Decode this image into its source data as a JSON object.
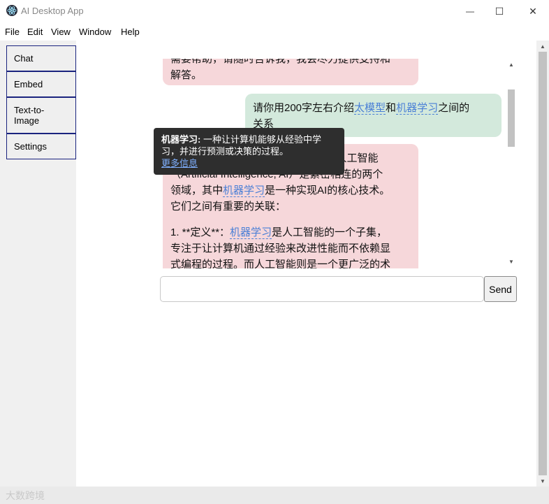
{
  "window": {
    "title": "AI Desktop App",
    "minimize_symbol": "—",
    "maximize_symbol": "☐",
    "close_symbol": "✕",
    "icon": "electron-atom-icon"
  },
  "menu": [
    "File",
    "Edit",
    "View",
    "Window",
    "Help"
  ],
  "sidebar": {
    "chat_label": "Chat",
    "embed_label": "Embed",
    "text_to_image_line1": "Text-to-",
    "text_to_image_line2": "Image",
    "settings_label": "Settings"
  },
  "messages": {
    "m1_line1": "需要帮助，请随时告诉我，我会尽力提供支持和",
    "m1_line2": "解答。",
    "m2_pre": "请你用200字左右介绍",
    "m2_link1": "太模型",
    "m2_mid": "和",
    "m2_link2": "机器学习",
    "m2_post": "之间的",
    "m2_line2": "关系",
    "m3_line1": "人工智能（Artificial Intelligence）和人工智能",
    "m3_line2": "（Artificial Intelligence, AI）是紧密相连的两个",
    "m3_l3_pre": "领域，其中",
    "m3_l3_link": "机器学习",
    "m3_l3_post": "是一种实现AI的核心技术。",
    "m3_line4": "它们之间有重要的关联：",
    "m3_l5_pre": "1. **定义**：",
    "m3_l5_link": "机器学习",
    "m3_l5_post": "是人工智能的一个子集，",
    "m3_line6": "专注于让计算机通过经验来改进性能而不依赖显",
    "m3_line7": "式编程的过程。而人工智能则是一个更广泛的术"
  },
  "tooltip": {
    "term": "机器学习:",
    "line1": " 一种让计算机能够从经验中学",
    "line2": "习，并进行预测或决策的过程。",
    "more_link": "更多信息"
  },
  "input": {
    "placeholder": "",
    "send_label": "Send"
  },
  "scroll": {
    "up_symbol": "▲",
    "down_symbol": "▼"
  },
  "watermark": "大数跨境",
  "colors": {
    "bot_bubble": "#f6d7da",
    "user_bubble": "#d3e9dc",
    "link": "#4a7fd6",
    "tooltip_bg": "#2e2e2e",
    "sidebar_border": "#1a237e"
  }
}
